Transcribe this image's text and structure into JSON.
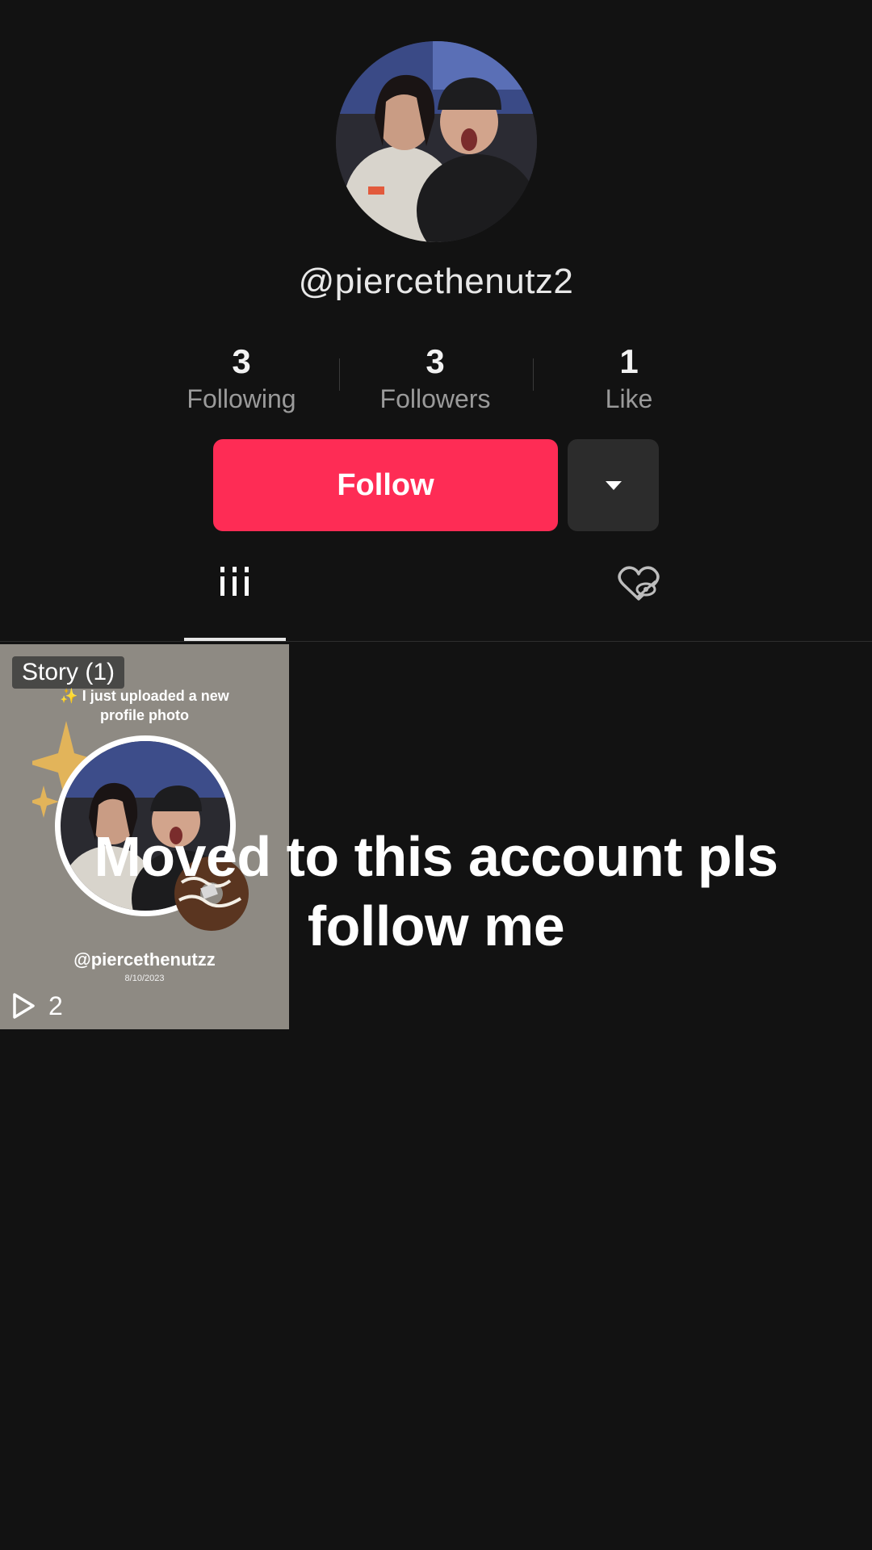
{
  "profile": {
    "username": "@piercethenutz2"
  },
  "stats": [
    {
      "value": "3",
      "label": "Following"
    },
    {
      "value": "3",
      "label": "Followers"
    },
    {
      "value": "1",
      "label": "Like"
    }
  ],
  "actions": {
    "follow_label": "Follow",
    "more_icon": "caret-down-icon"
  },
  "tabs": {
    "videos_icon": "grid-bars-icon",
    "liked_icon": "hidden-heart-icon",
    "active": "videos"
  },
  "videos": [
    {
      "badge": "Story (1)",
      "caption_line1": "✨ I just uploaded a new",
      "caption_line2": "profile photo",
      "handle": "@piercethenutzz",
      "date": "8/10/2023",
      "views": "2"
    }
  ],
  "overlay": {
    "line1": "Moved to this account pls",
    "line2": "follow me"
  },
  "colors": {
    "background": "#121212",
    "follow_button": "#fe2c55",
    "secondary_button": "#2c2c2c",
    "tile_background": "#8e8a83"
  }
}
